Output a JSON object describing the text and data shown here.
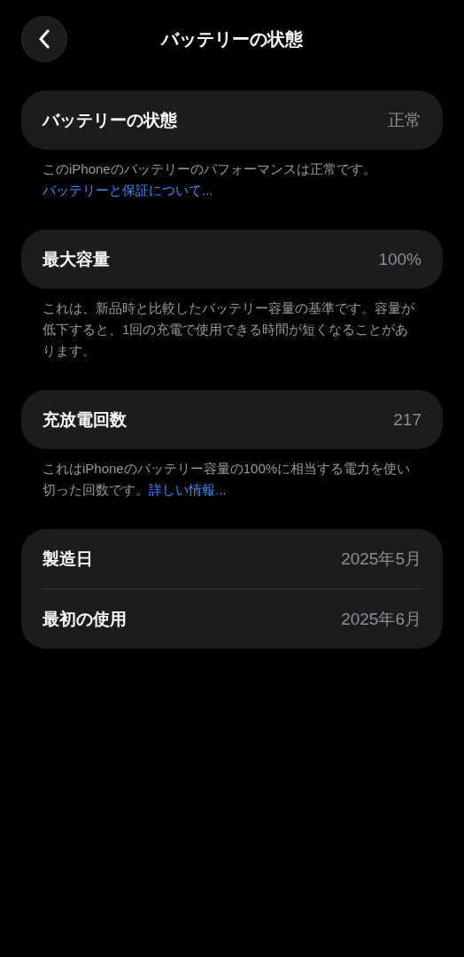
{
  "header": {
    "title": "バッテリーの状態"
  },
  "sections": [
    {
      "rows": [
        {
          "label": "バッテリーの状態",
          "value": "正常"
        }
      ],
      "footer": {
        "text": "このiPhoneのバッテリーのパフォーマンスは正常です。",
        "link": "バッテリーと保証について..."
      }
    },
    {
      "rows": [
        {
          "label": "最大容量",
          "value": "100%"
        }
      ],
      "footer": {
        "text": "これは、新品時と比較したバッテリー容量の基準です。容量が低下すると、1回の充電で使用できる時間が短くなることがあります。"
      }
    },
    {
      "rows": [
        {
          "label": "充放電回数",
          "value": "217"
        }
      ],
      "footer": {
        "text": "これはiPhoneのバッテリー容量の100%に相当する電力を使い切った回数です。",
        "link": "詳しい情報..."
      }
    },
    {
      "rows": [
        {
          "label": "製造日",
          "value": "2025年5月"
        },
        {
          "label": "最初の使用",
          "value": "2025年6月"
        }
      ]
    }
  ]
}
